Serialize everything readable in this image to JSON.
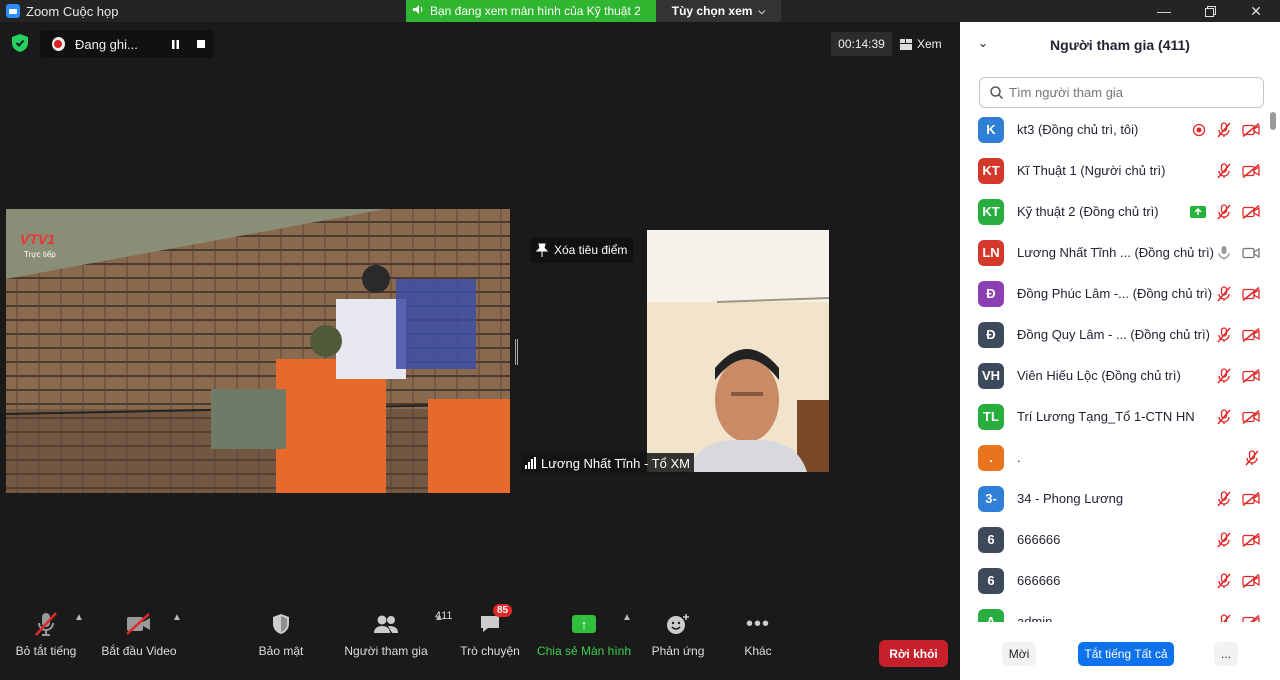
{
  "window": {
    "title": "Zoom Cuộc họp",
    "share_banner": "Bạn đang xem màn hình của Kỹ thuật 2",
    "view_options": "Tùy chọn xem"
  },
  "meeting": {
    "recording_label": "Đang ghi...",
    "timer": "00:14:39",
    "view_label": "Xem",
    "unpin_label": "Xóa tiêu điểm",
    "video_name": "Lương Nhất Tĩnh - Tổ XM",
    "shared_logo": "VTV1",
    "shared_live": "Trực tiếp"
  },
  "toolbar": {
    "mute_all": "Bỏ tắt tiếng",
    "start_video": "Bắt đầu Video",
    "security": "Bảo mật",
    "participants": "Người tham gia",
    "participants_count": "411",
    "chat": "Trò chuyện",
    "chat_badge": "85",
    "share": "Chia sẻ Màn hình",
    "reactions": "Phản ứng",
    "more": "Khác",
    "leave": "Rời khỏi"
  },
  "panel": {
    "title": "Người tham gia (411)",
    "search_placeholder": "Tìm người tham gia",
    "participants": [
      {
        "initials": "K",
        "name": "kt3 (Đồng chủ trì, tôi)",
        "color": "#2f7fd6",
        "icons": [
          "record-icon",
          "mic-muted-icon",
          "video-off-icon"
        ]
      },
      {
        "initials": "KT",
        "name": "Kĩ Thuật 1 (Người chủ trì)",
        "color": "#d3382a",
        "icons": [
          "mic-muted-icon",
          "video-off-icon"
        ]
      },
      {
        "initials": "KT",
        "name": "Kỹ thuật 2 (Đồng chủ trì)",
        "color": "#27ae3e",
        "icons": [
          "share-screen-icon",
          "mic-muted-icon",
          "video-off-icon"
        ]
      },
      {
        "initials": "LN",
        "name": "Lương Nhất Tĩnh ... (Đồng chủ trì)",
        "color": "#d3382a",
        "icons": [
          "mic-icon",
          "video-icon"
        ]
      },
      {
        "initials": "Đ",
        "name": "Đồng Phúc Lâm -... (Đồng chủ trì)",
        "color": "#8b3fb3",
        "icons": [
          "mic-muted-icon",
          "video-off-icon"
        ]
      },
      {
        "initials": "Đ",
        "name": "Đồng Quy Lâm - ... (Đồng chủ trì)",
        "color": "#3c4a5c",
        "icons": [
          "mic-muted-icon",
          "video-off-icon"
        ]
      },
      {
        "initials": "VH",
        "name": "Viên Hiếu Lộc (Đồng chủ trì)",
        "color": "#3c4a5c",
        "icons": [
          "mic-muted-icon",
          "video-off-icon"
        ]
      },
      {
        "initials": "TL",
        "name": " Trí Lương Tạng_Tổ 1-CTN HN",
        "color": "#27ae3e",
        "icons": [
          "mic-muted-icon",
          "video-off-icon"
        ]
      },
      {
        "initials": ".",
        "name": ".",
        "color": "#e8741e",
        "icons": [
          "mic-muted-icon"
        ]
      },
      {
        "initials": "3-",
        "name": "34 - Phong Lương",
        "color": "#2f7fd6",
        "icons": [
          "mic-muted-icon",
          "video-off-icon"
        ]
      },
      {
        "initials": "6",
        "name": "666666",
        "color": "#3c4a5c",
        "icons": [
          "mic-muted-icon",
          "video-off-icon"
        ]
      },
      {
        "initials": "6",
        "name": "666666",
        "color": "#3c4a5c",
        "icons": [
          "mic-muted-icon",
          "video-off-icon"
        ]
      },
      {
        "initials": "A",
        "name": "admin",
        "color": "#27ae3e",
        "icons": [
          "mic-muted-icon",
          "video-off-icon"
        ]
      }
    ],
    "invite": "Mời",
    "mute_all": "Tắt tiếng Tất cả",
    "more": "..."
  },
  "colors": {
    "accent_blue": "#0e72ed",
    "share_green": "#2fb52f",
    "muted_red": "#e02828",
    "leave_red": "#c7202b"
  }
}
